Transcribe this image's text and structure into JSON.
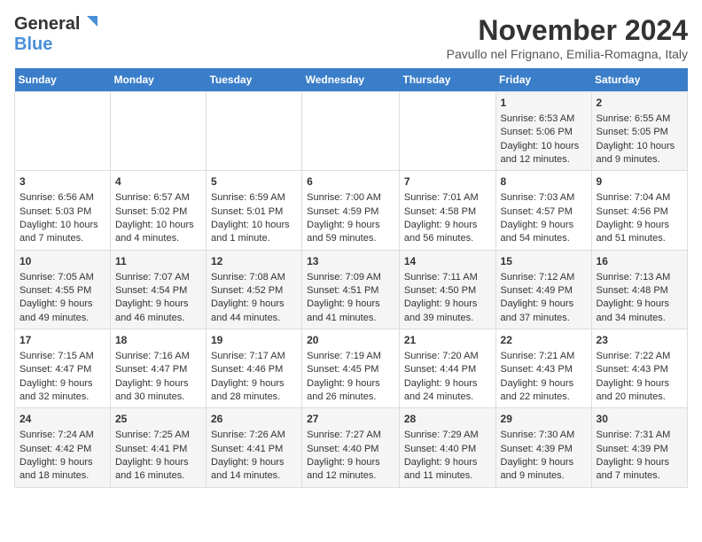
{
  "logo": {
    "line1": "General",
    "line2": "Blue"
  },
  "title": "November 2024",
  "subtitle": "Pavullo nel Frignano, Emilia-Romagna, Italy",
  "days_of_week": [
    "Sunday",
    "Monday",
    "Tuesday",
    "Wednesday",
    "Thursday",
    "Friday",
    "Saturday"
  ],
  "weeks": [
    [
      {
        "day": "",
        "info": ""
      },
      {
        "day": "",
        "info": ""
      },
      {
        "day": "",
        "info": ""
      },
      {
        "day": "",
        "info": ""
      },
      {
        "day": "",
        "info": ""
      },
      {
        "day": "1",
        "info": "Sunrise: 6:53 AM\nSunset: 5:06 PM\nDaylight: 10 hours and 12 minutes."
      },
      {
        "day": "2",
        "info": "Sunrise: 6:55 AM\nSunset: 5:05 PM\nDaylight: 10 hours and 9 minutes."
      }
    ],
    [
      {
        "day": "3",
        "info": "Sunrise: 6:56 AM\nSunset: 5:03 PM\nDaylight: 10 hours and 7 minutes."
      },
      {
        "day": "4",
        "info": "Sunrise: 6:57 AM\nSunset: 5:02 PM\nDaylight: 10 hours and 4 minutes."
      },
      {
        "day": "5",
        "info": "Sunrise: 6:59 AM\nSunset: 5:01 PM\nDaylight: 10 hours and 1 minute."
      },
      {
        "day": "6",
        "info": "Sunrise: 7:00 AM\nSunset: 4:59 PM\nDaylight: 9 hours and 59 minutes."
      },
      {
        "day": "7",
        "info": "Sunrise: 7:01 AM\nSunset: 4:58 PM\nDaylight: 9 hours and 56 minutes."
      },
      {
        "day": "8",
        "info": "Sunrise: 7:03 AM\nSunset: 4:57 PM\nDaylight: 9 hours and 54 minutes."
      },
      {
        "day": "9",
        "info": "Sunrise: 7:04 AM\nSunset: 4:56 PM\nDaylight: 9 hours and 51 minutes."
      }
    ],
    [
      {
        "day": "10",
        "info": "Sunrise: 7:05 AM\nSunset: 4:55 PM\nDaylight: 9 hours and 49 minutes."
      },
      {
        "day": "11",
        "info": "Sunrise: 7:07 AM\nSunset: 4:54 PM\nDaylight: 9 hours and 46 minutes."
      },
      {
        "day": "12",
        "info": "Sunrise: 7:08 AM\nSunset: 4:52 PM\nDaylight: 9 hours and 44 minutes."
      },
      {
        "day": "13",
        "info": "Sunrise: 7:09 AM\nSunset: 4:51 PM\nDaylight: 9 hours and 41 minutes."
      },
      {
        "day": "14",
        "info": "Sunrise: 7:11 AM\nSunset: 4:50 PM\nDaylight: 9 hours and 39 minutes."
      },
      {
        "day": "15",
        "info": "Sunrise: 7:12 AM\nSunset: 4:49 PM\nDaylight: 9 hours and 37 minutes."
      },
      {
        "day": "16",
        "info": "Sunrise: 7:13 AM\nSunset: 4:48 PM\nDaylight: 9 hours and 34 minutes."
      }
    ],
    [
      {
        "day": "17",
        "info": "Sunrise: 7:15 AM\nSunset: 4:47 PM\nDaylight: 9 hours and 32 minutes."
      },
      {
        "day": "18",
        "info": "Sunrise: 7:16 AM\nSunset: 4:47 PM\nDaylight: 9 hours and 30 minutes."
      },
      {
        "day": "19",
        "info": "Sunrise: 7:17 AM\nSunset: 4:46 PM\nDaylight: 9 hours and 28 minutes."
      },
      {
        "day": "20",
        "info": "Sunrise: 7:19 AM\nSunset: 4:45 PM\nDaylight: 9 hours and 26 minutes."
      },
      {
        "day": "21",
        "info": "Sunrise: 7:20 AM\nSunset: 4:44 PM\nDaylight: 9 hours and 24 minutes."
      },
      {
        "day": "22",
        "info": "Sunrise: 7:21 AM\nSunset: 4:43 PM\nDaylight: 9 hours and 22 minutes."
      },
      {
        "day": "23",
        "info": "Sunrise: 7:22 AM\nSunset: 4:43 PM\nDaylight: 9 hours and 20 minutes."
      }
    ],
    [
      {
        "day": "24",
        "info": "Sunrise: 7:24 AM\nSunset: 4:42 PM\nDaylight: 9 hours and 18 minutes."
      },
      {
        "day": "25",
        "info": "Sunrise: 7:25 AM\nSunset: 4:41 PM\nDaylight: 9 hours and 16 minutes."
      },
      {
        "day": "26",
        "info": "Sunrise: 7:26 AM\nSunset: 4:41 PM\nDaylight: 9 hours and 14 minutes."
      },
      {
        "day": "27",
        "info": "Sunrise: 7:27 AM\nSunset: 4:40 PM\nDaylight: 9 hours and 12 minutes."
      },
      {
        "day": "28",
        "info": "Sunrise: 7:29 AM\nSunset: 4:40 PM\nDaylight: 9 hours and 11 minutes."
      },
      {
        "day": "29",
        "info": "Sunrise: 7:30 AM\nSunset: 4:39 PM\nDaylight: 9 hours and 9 minutes."
      },
      {
        "day": "30",
        "info": "Sunrise: 7:31 AM\nSunset: 4:39 PM\nDaylight: 9 hours and 7 minutes."
      }
    ]
  ]
}
